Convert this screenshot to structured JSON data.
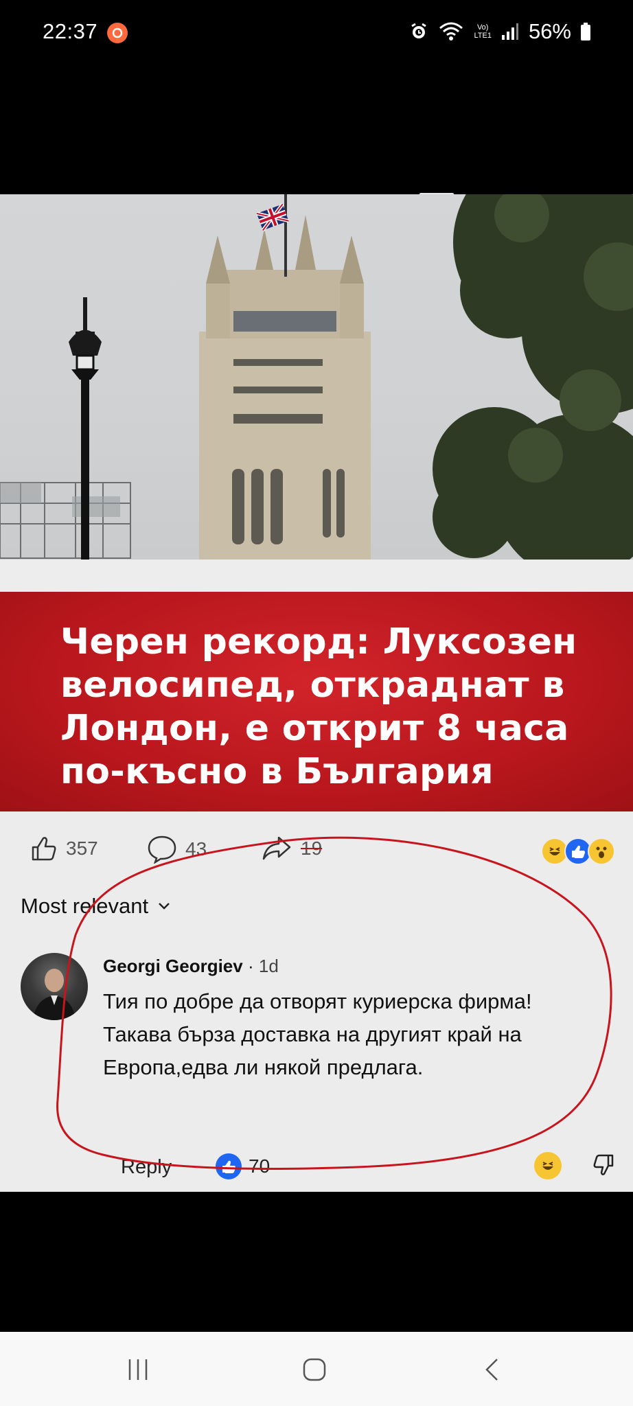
{
  "status_bar": {
    "time": "22:37",
    "battery": "56%",
    "network": "LTE1",
    "volte": "Vo)"
  },
  "article": {
    "headline": "Черен рекорд: Луксозен велосипед, откраднат в Лондон, е открит 8 часа по-късно в България",
    "banner_color": "#c41c22"
  },
  "post_stats": {
    "likes": "357",
    "comments": "43",
    "shares": "19",
    "reactions": [
      "haha-icon",
      "like-icon",
      "wow-icon"
    ]
  },
  "sort": {
    "label": "Most relevant"
  },
  "comment": {
    "author": "Georgi Georgiev",
    "time": "1d",
    "text": "Тия по добре да отворят куриерска фирма! Такава бърза доставка на другият край на Европа,едва ли някой предлага.",
    "reply_label": "Reply",
    "like_count": "70",
    "reaction": "haha-icon"
  },
  "annotation": {
    "circle_color": "#c8141c"
  },
  "nav": {
    "items": [
      "recents-icon",
      "home-icon",
      "back-icon"
    ]
  }
}
